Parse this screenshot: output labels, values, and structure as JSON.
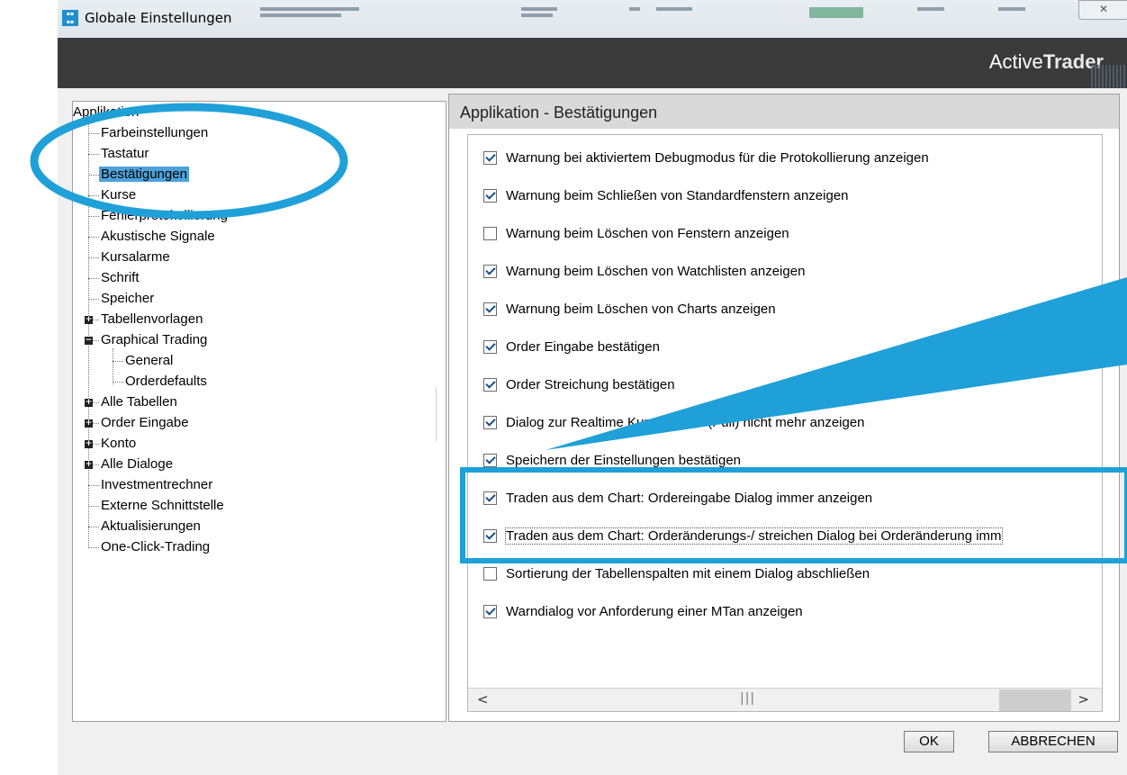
{
  "window": {
    "title": "Globale Einstellungen",
    "close_glyph": "✕"
  },
  "brand": {
    "part1": "Active",
    "part2": "Trader"
  },
  "tree": {
    "root": "Applikation",
    "items": [
      "Farbeinstellungen",
      "Tastatur",
      "Bestätigungen",
      "Kurse",
      "Fehlerprotokollierung",
      "Akustische Signale",
      "Kursalarme",
      "Schrift",
      "Speicher",
      "Tabellenvorlagen",
      "Graphical Trading",
      "General",
      "Orderdefaults",
      "Alle Tabellen",
      "Order Eingabe",
      "Konto",
      "Alle Dialoge",
      "Investmentrechner",
      "Externe Schnittstelle",
      "Aktualisierungen",
      "One-Click-Trading"
    ],
    "selected": "Bestätigungen"
  },
  "section": {
    "title": "Applikation - Bestätigungen"
  },
  "options": [
    {
      "label": "Warnung bei aktiviertem Debugmodus für die Protokollierung anzeigen",
      "checked": true
    },
    {
      "label": "Warnung beim Schließen von Standardfenstern anzeigen",
      "checked": true
    },
    {
      "label": "Warnung beim Löschen von Fenstern anzeigen",
      "checked": false
    },
    {
      "label": "Warnung beim Löschen von Watchlisten anzeigen",
      "checked": true
    },
    {
      "label": "Warnung beim Löschen von Charts anzeigen",
      "checked": true
    },
    {
      "label": "Order Eingabe bestätigen",
      "checked": true
    },
    {
      "label": "Order Streichung bestätigen",
      "checked": true
    },
    {
      "label": "Dialog zur Realtime Kursfreigabe (Pull) nicht mehr anzeigen",
      "checked": true
    },
    {
      "label": "Speichern der Einstellungen bestätigen",
      "checked": true
    },
    {
      "label": "Traden aus dem Chart: Ordereingabe Dialog immer anzeigen",
      "checked": true
    },
    {
      "label": "Traden aus dem Chart: Orderänderungs-/ streichen Dialog bei Orderänderung imm",
      "checked": true
    },
    {
      "label": "Sortierung der Tabellenspalten mit einem Dialog abschließen",
      "checked": false
    },
    {
      "label": "Warndialog vor Anforderung einer MTan anzeigen",
      "checked": true
    }
  ],
  "scrollbar": {
    "left_glyph": "<",
    "right_glyph": ">",
    "grip": "|||"
  },
  "buttons": {
    "ok": "OK",
    "cancel": "ABBRECHEN"
  },
  "colors": {
    "annotation": "#1fa0d8",
    "selection": "#4da3d9",
    "brand_bar": "#3a3a3a"
  }
}
